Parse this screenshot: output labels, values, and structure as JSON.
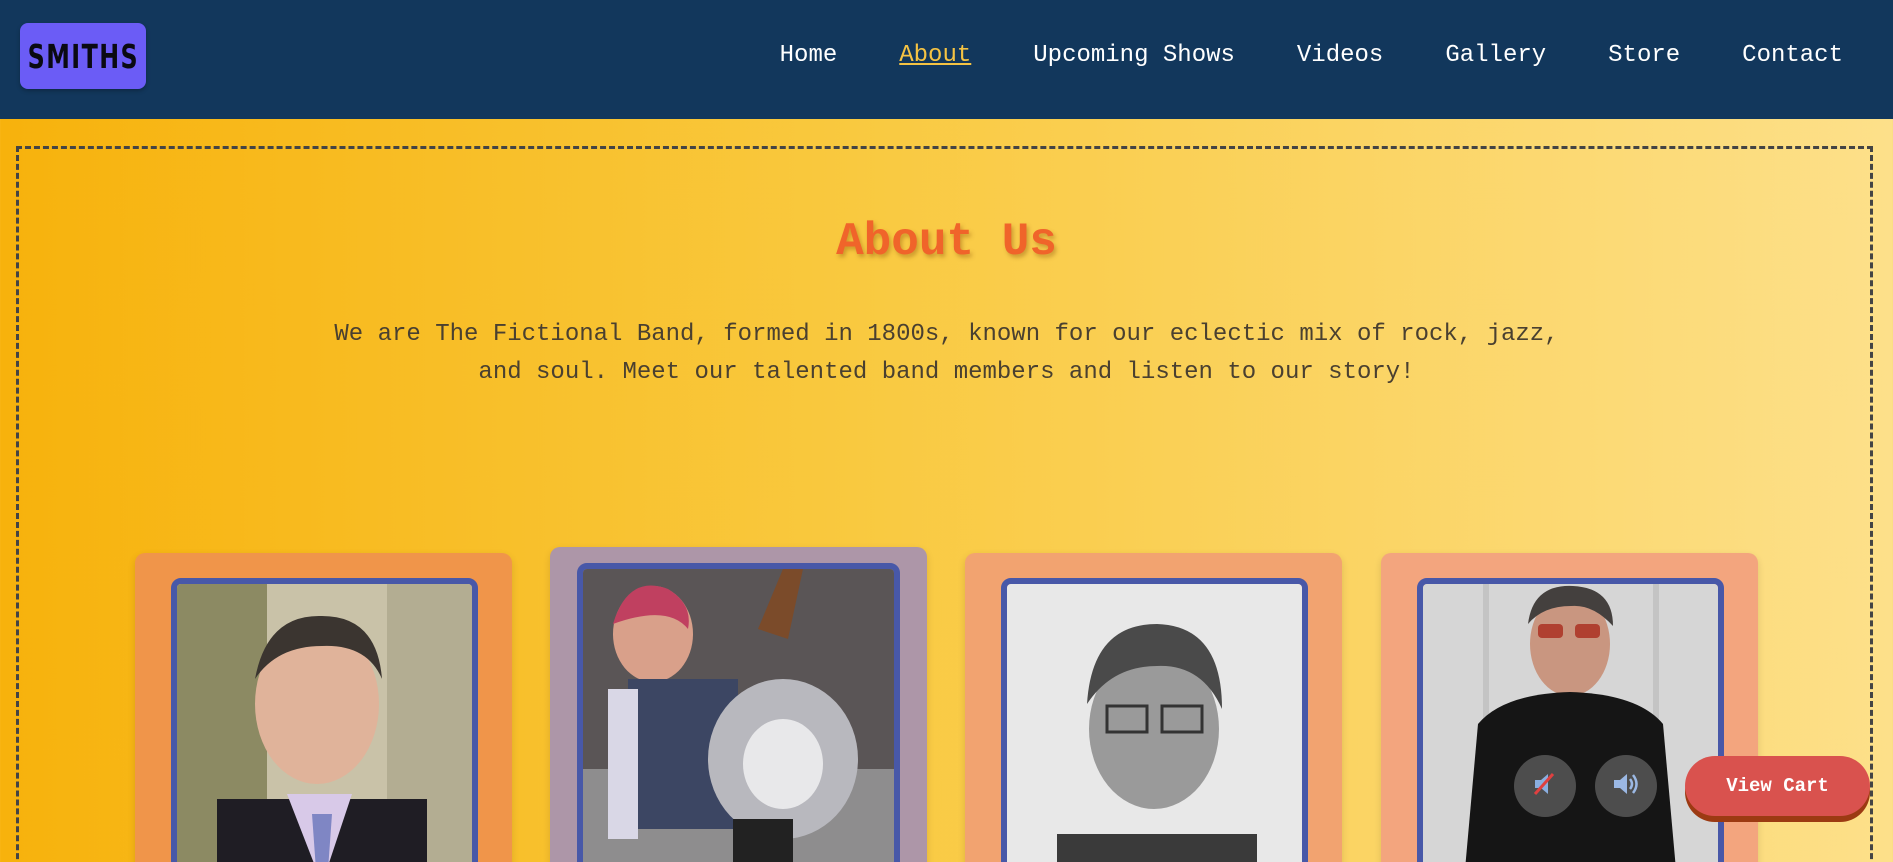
{
  "header": {
    "logo_text": "SMITHS",
    "nav": [
      {
        "label": "Home",
        "active": false
      },
      {
        "label": "About",
        "active": true
      },
      {
        "label": "Upcoming Shows",
        "active": false
      },
      {
        "label": "Videos",
        "active": false
      },
      {
        "label": "Gallery",
        "active": false
      },
      {
        "label": "Store",
        "active": false
      },
      {
        "label": "Contact",
        "active": false
      }
    ]
  },
  "about": {
    "title": "About Us",
    "intro": "We are The Fictional Band, formed in 1800s, known for our eclectic mix of rock, jazz, and soul. Meet our talented band members and listen to our story!"
  },
  "members": [
    {
      "photo": "member-photo-1",
      "card_color": "#f0954a"
    },
    {
      "photo": "member-photo-2",
      "card_color": "#ad96a8"
    },
    {
      "photo": "member-photo-3",
      "card_color": "#f2a370"
    },
    {
      "photo": "member-photo-4",
      "card_color": "#f3a57e"
    }
  ],
  "controls": {
    "mute_icon": "speaker-muted-icon",
    "volume_icon": "speaker-volume-icon",
    "cart_label": "View Cart"
  },
  "colors": {
    "header_bg": "#12375c",
    "logo_bg": "#6b5cf6",
    "nav_active": "#f5c343",
    "title": "#f0642a",
    "photo_border": "#4858a8",
    "cart_button": "#d9524e"
  }
}
